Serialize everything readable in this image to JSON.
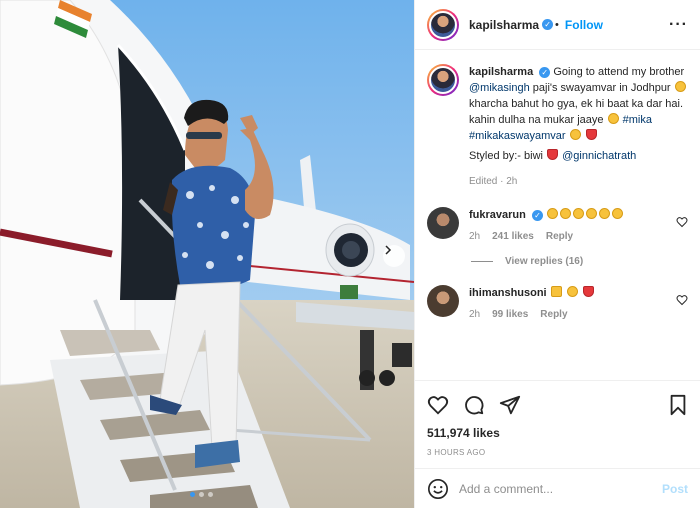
{
  "post_author": {
    "username": "kapilsharma",
    "follow_label": "Follow",
    "more_label": "···"
  },
  "caption": {
    "username": "kapilsharma",
    "text_1": "Going to attend my brother",
    "mention_1": "@mikasingh",
    "text_2": "paji's swayamvar in Jodhpur",
    "text_3": "kharcha bahut ho gya, ek hi baat ka dar hai. kahin dulha na mukar jaaye",
    "hashtag_1": "#mika",
    "hashtag_2": "#mikakaswayamvar",
    "styled_by": "Styled by:- biwi",
    "mention_2": "@ginnichatrath",
    "edited": "Edited · 2h"
  },
  "comments": [
    {
      "username": "fukravarun",
      "time": "2h",
      "likes": "241 likes",
      "reply": "Reply",
      "view_replies": "View replies (16)"
    },
    {
      "username": "ihimanshusoni",
      "time": "2h",
      "likes": "99 likes",
      "reply": "Reply"
    }
  ],
  "likes_count": "511,974 likes",
  "time_ago": "3 HOURS AGO",
  "add_comment": {
    "placeholder": "Add a comment...",
    "post_label": "Post"
  },
  "icons": {
    "like": "heart-icon",
    "comment": "comment-icon",
    "share": "share-icon",
    "save": "bookmark-icon",
    "emoji": "smiley-icon",
    "next": "chevron-right-icon",
    "verified": "verified-badge-icon"
  },
  "colors": {
    "link": "#0095f6",
    "tag": "#00376b",
    "meta": "#8e8e8e",
    "verified": "#3897f0"
  },
  "carousel": {
    "current": 1,
    "total": 3
  }
}
